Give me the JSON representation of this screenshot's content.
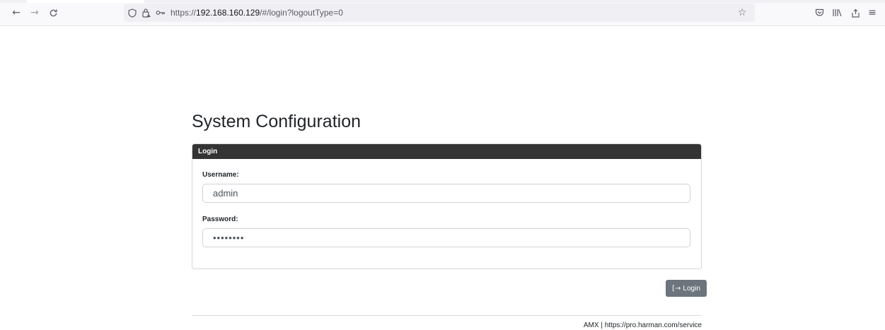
{
  "browser": {
    "url_prefix": "https://",
    "url_host": "192.168.160.129",
    "url_path": "/#/login?logoutType=0",
    "icons": {
      "back": "arrow-left-icon",
      "forward": "arrow-right-icon",
      "reload": "reload-icon",
      "shield": "shield-icon",
      "lock": "lock-warning-icon",
      "key": "key-icon",
      "bookmark": "star-icon",
      "pocket": "pocket-icon",
      "library": "library-icon",
      "share": "share-icon",
      "menu": "hamburger-menu-icon"
    }
  },
  "page": {
    "title": "System Configuration"
  },
  "login_card": {
    "header": "Login",
    "username_label": "Username:",
    "username_value": "admin",
    "password_label": "Password:",
    "password_value": "••••••••"
  },
  "actions": {
    "login_label": "Login",
    "login_icon": "sign-in-icon",
    "button_color": "#6c757d"
  },
  "footer": {
    "text": "AMX | https://pro.harman.com/service"
  }
}
